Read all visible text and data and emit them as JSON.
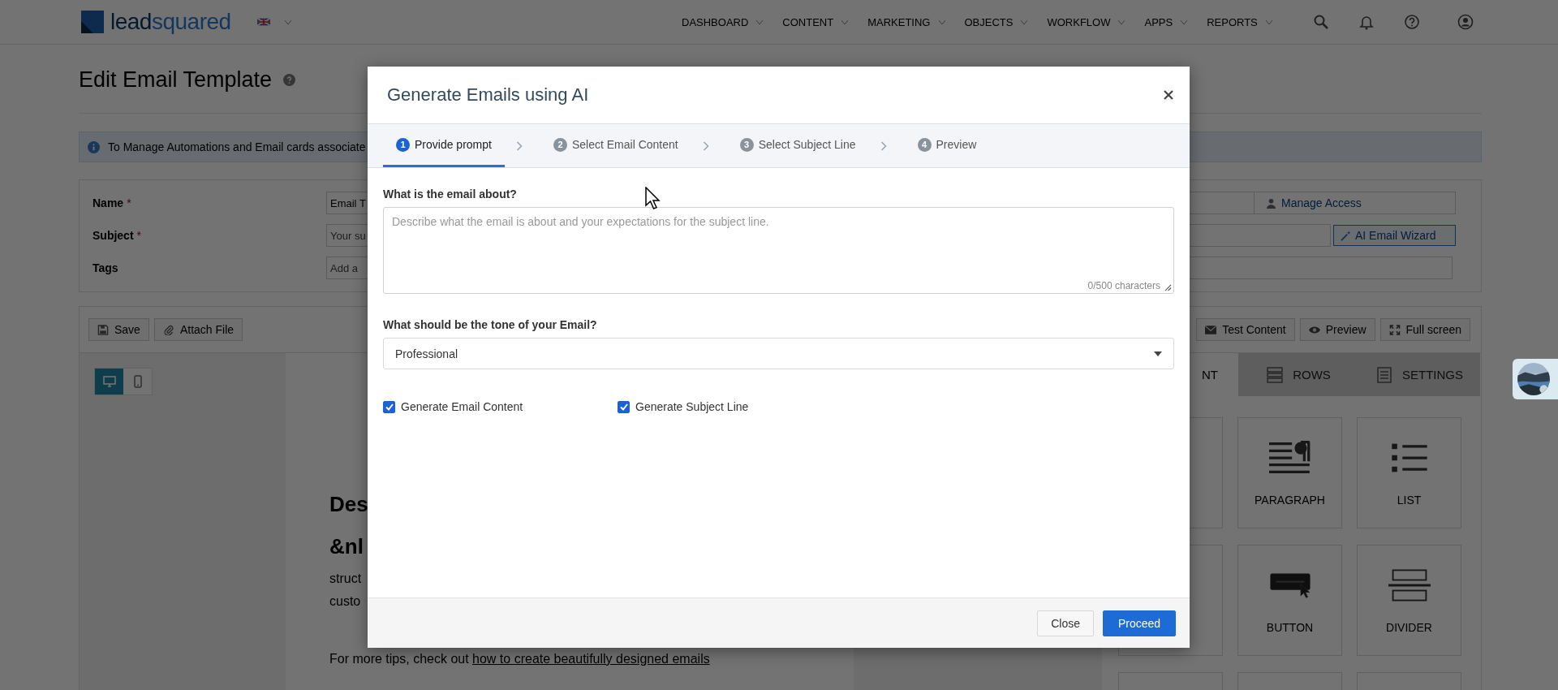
{
  "topbar": {
    "logo": {
      "first": "lead",
      "second": "squared"
    },
    "nav": [
      {
        "label": "DASHBOARD"
      },
      {
        "label": "CONTENT"
      },
      {
        "label": "MARKETING"
      },
      {
        "label": "OBJECTS"
      },
      {
        "label": "WORKFLOW"
      },
      {
        "label": "APPS"
      },
      {
        "label": "REPORTS"
      }
    ]
  },
  "page": {
    "title": "Edit Email Template",
    "info": "To Manage Automations and Email cards associate",
    "form": [
      {
        "label": "Name",
        "required_mark": "*",
        "value": "Email T",
        "kind": "access",
        "action": "Manage Access"
      },
      {
        "label": "Subject",
        "required_mark": "*",
        "placeholder": "Your su",
        "kind": "wizard",
        "action": "AI Email Wizard"
      },
      {
        "label": "Tags",
        "placeholder": "Add a",
        "kind": "plain"
      }
    ],
    "toolbar_left": [
      {
        "kind": "save",
        "label": "Save"
      },
      {
        "kind": "attach",
        "label": "Attach File"
      }
    ],
    "toolbar_right": [
      {
        "kind": "test",
        "label": "Test Content"
      },
      {
        "kind": "preview",
        "label": "Preview"
      },
      {
        "kind": "fullscreen",
        "label": "Full screen"
      }
    ],
    "devices": [
      {
        "kind": "desktop",
        "selected": true
      },
      {
        "kind": "mobile",
        "selected": false
      }
    ],
    "canvas": {
      "heading_lines": [
        "Des",
        "&nl"
      ],
      "body_lines": [
        "struct",
        "custo"
      ],
      "tips_prefix": "For more tips, check out",
      "tips_link": "how to create beautifully designed emails"
    },
    "panel_tabs": [
      {
        "kind": "content",
        "label": "NT",
        "selected": true
      },
      {
        "kind": "rows",
        "label": "ROWS",
        "selected": false
      },
      {
        "kind": "settings",
        "label": "SETTINGS",
        "selected": false
      }
    ],
    "blocks": [
      {
        "kind": "empty"
      },
      {
        "kind": "paragraph",
        "label": "PARAGRAPH"
      },
      {
        "kind": "list",
        "label": "LIST"
      },
      {
        "kind": "empty"
      },
      {
        "kind": "button",
        "label": "BUTTON"
      },
      {
        "kind": "divider",
        "label": "DIVIDER"
      },
      {
        "kind": "empty"
      },
      {
        "kind": "empty"
      },
      {
        "kind": "empty"
      }
    ]
  },
  "modal": {
    "title": "Generate Emails using AI",
    "steps": [
      {
        "number": "1",
        "label": "Provide prompt",
        "selected": true
      },
      {
        "number": "2",
        "label": "Select Email Content",
        "selected": false
      },
      {
        "number": "3",
        "label": "Select Subject Line",
        "selected": false
      },
      {
        "number": "4",
        "label": "Preview",
        "selected": false
      }
    ],
    "prompt_label": "What is the email about?",
    "prompt_placeholder": "Describe what the email is about and your expectations for the subject line.",
    "counter": "0/500 characters",
    "tone_label": "What should be the tone of your Email?",
    "tone_value": "Professional",
    "options": [
      {
        "label": "Generate Email Content",
        "checked": true
      },
      {
        "label": "Generate Subject Line",
        "checked": true
      }
    ],
    "buttons": [
      {
        "kind": "secondary",
        "label": "Close"
      },
      {
        "kind": "primary",
        "label": "Proceed"
      }
    ]
  }
}
